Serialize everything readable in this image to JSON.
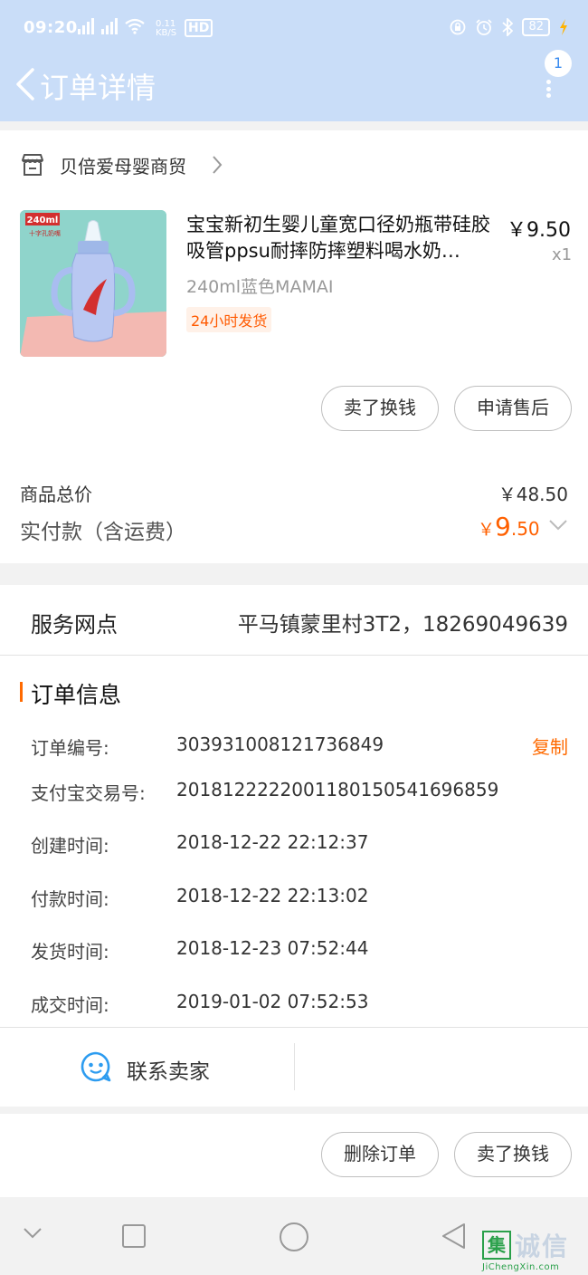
{
  "status": {
    "time": "09:20",
    "net1": "4G",
    "net2": "2G",
    "speed_value": "0.11",
    "speed_unit": "KB/S",
    "hd": "HD",
    "battery": "82"
  },
  "header": {
    "title": "订单详情",
    "message_count": "1"
  },
  "shop": {
    "name": "贝倍爱母婴商贸"
  },
  "product": {
    "title": "宝宝新初生婴儿童宽口径奶瓶带硅胶吸管ppsu耐摔防摔塑料喝水奶…",
    "price": "￥9.50",
    "quantity": "x1",
    "sku": "240ml蓝色MAMAI",
    "tag": "24小时发货",
    "image_badge": "240ml",
    "image_caption": "十字孔奶嘴"
  },
  "item_actions": {
    "resell": "卖了换钱",
    "after_sale": "申请售后"
  },
  "summary": {
    "goods_total_label": "商品总价",
    "goods_total_value": "￥48.50",
    "paid_label": "实付款（含运费）",
    "paid_currency": "￥",
    "paid_integer": "9",
    "paid_decimal": ".50"
  },
  "service": {
    "label": "服务网点",
    "value": "平马镇蒙里村3T2，18269049639"
  },
  "order_info": {
    "title": "订单信息",
    "copy_label": "复制",
    "rows": [
      {
        "label": "订单编号:",
        "value": "303931008121736849"
      },
      {
        "label": "支付宝交易号:",
        "value": "2018122222001180150541696859"
      },
      {
        "label": "创建时间:",
        "value": "2018-12-22 22:12:37"
      },
      {
        "label": "付款时间:",
        "value": "2018-12-22 22:13:02"
      },
      {
        "label": "发货时间:",
        "value": "2018-12-23 07:52:44"
      },
      {
        "label": "成交时间:",
        "value": "2019-01-02 07:52:53"
      }
    ]
  },
  "contact": {
    "label": "联系卖家"
  },
  "bottom_actions": {
    "delete": "删除订单",
    "resell": "卖了换钱"
  },
  "watermark": {
    "glyph": "集",
    "text": "诚信",
    "sub": "JiChengXin.com"
  },
  "colors": {
    "header_bg": "#c9ddf8",
    "accent": "#ff6a00",
    "icon_blue": "#2d9cf0"
  }
}
